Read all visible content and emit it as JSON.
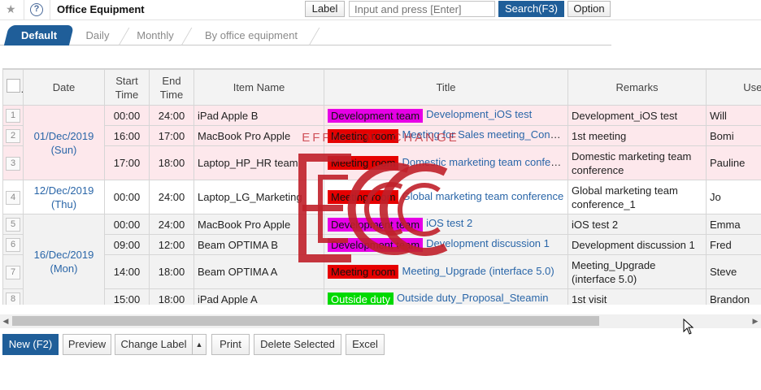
{
  "header": {
    "title": "Office Equipment",
    "label_button": "Label",
    "search_placeholder": "Input and press [Enter]",
    "search_button": "Search(F3)",
    "option_button": "Option"
  },
  "tabs": [
    "Default",
    "Daily",
    "Monthly",
    "By office equipment"
  ],
  "table": {
    "columns": [
      "Date",
      "Start Time",
      "End Time",
      "Item Name",
      "Title",
      "Remarks",
      "User"
    ],
    "rows": [
      {
        "no": "1",
        "start": "00:00",
        "end": "24:00",
        "item": "iPad Apple B",
        "label": "Development team",
        "label_color": "#e600e6",
        "title": "Development_iOS test",
        "remarks": "Development_iOS test",
        "user": "Will"
      },
      {
        "no": "2",
        "start": "16:00",
        "end": "17:00",
        "item": "MacBook Pro Apple",
        "label": "Meeting room",
        "label_color": "#e60000",
        "title": "Meeting for Sales meeting_Cong Cafe",
        "remarks": "1st meeting",
        "user": "Bomi"
      },
      {
        "no": "3",
        "start": "17:00",
        "end": "18:00",
        "item": "Laptop_HP_HR team",
        "label": "Meeting room",
        "label_color": "#e60000",
        "title": "Domestic marketing team conference",
        "remarks": "Domestic marketing team conference",
        "user": "Pauline"
      },
      {
        "no": "4",
        "start": "00:00",
        "end": "24:00",
        "item": "Laptop_LG_Marketing",
        "label": "Meeting room",
        "label_color": "#e60000",
        "title": "Global marketing team conference",
        "remarks": "Global marketing team conference_1",
        "user": "Jo"
      },
      {
        "no": "5",
        "start": "00:00",
        "end": "24:00",
        "item": "MacBook Pro Apple",
        "label": "Development team",
        "label_color": "#e600e6",
        "title": "iOS test 2",
        "remarks": "iOS test 2",
        "user": "Emma"
      },
      {
        "no": "6",
        "start": "09:00",
        "end": "12:00",
        "item": "Beam OPTIMA B",
        "label": "Development team",
        "label_color": "#e600e6",
        "title": "Development discussion 1",
        "remarks": "Development discussion 1",
        "user": "Fred"
      },
      {
        "no": "7",
        "start": "14:00",
        "end": "18:00",
        "item": "Beam OPTIMA A",
        "label": "Meeting room",
        "label_color": "#e60000",
        "title": "Meeting_Upgrade (interface 5.0)",
        "remarks": "Meeting_Upgrade (interface 5.0)",
        "user": "Steve"
      },
      {
        "no": "8",
        "start": "15:00",
        "end": "18:00",
        "item": "iPad Apple A",
        "label": "Outside duty",
        "label_color": "#00d900",
        "title": "Outside duty_Proposal_Steamin",
        "remarks": "1st visit",
        "user": "Brandon"
      }
    ],
    "dates": [
      {
        "date": "01/Dec/2019",
        "weekday": "(Sun)"
      },
      {
        "date": "12/Dec/2019",
        "weekday": "(Thu)"
      },
      {
        "date": "16/Dec/2019",
        "weekday": "(Mon)"
      }
    ]
  },
  "footer": {
    "new_button": "New (F2)",
    "preview_button": "Preview",
    "change_label_button": "Change Label",
    "print_button": "Print",
    "delete_button": "Delete Selected",
    "excel_button": "Excel"
  },
  "watermark": {
    "text": "EFFICIENT CHANGE",
    "color": "#c0202a"
  },
  "colors": {
    "primary": "#1f5e99",
    "link": "#2a66a8",
    "group_highlight": "#fde8ec"
  }
}
